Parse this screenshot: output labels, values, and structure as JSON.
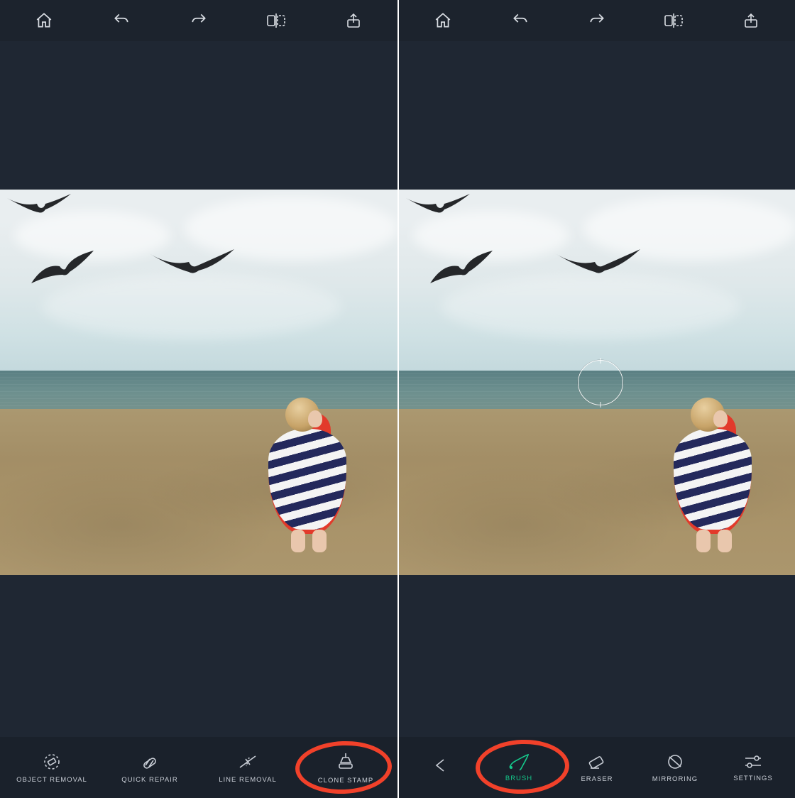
{
  "left": {
    "top_icons": [
      "home-icon",
      "undo-icon",
      "redo-icon",
      "compare-icon",
      "share-icon"
    ],
    "tools": [
      {
        "id": "object-removal",
        "label": "OBJECT REMOVAL"
      },
      {
        "id": "quick-repair",
        "label": "QUICK REPAIR"
      },
      {
        "id": "line-removal",
        "label": "LINE REMOVAL"
      },
      {
        "id": "clone-stamp",
        "label": "CLONE STAMP"
      }
    ],
    "highlighted_tool": "clone-stamp"
  },
  "right": {
    "top_icons": [
      "home-icon",
      "undo-icon",
      "redo-icon",
      "compare-icon",
      "share-icon"
    ],
    "tools": [
      {
        "id": "back",
        "label": ""
      },
      {
        "id": "brush",
        "label": "BRUSH"
      },
      {
        "id": "eraser",
        "label": "ERASER"
      },
      {
        "id": "mirroring",
        "label": "MIRRORING"
      },
      {
        "id": "settings",
        "label": "SETTINGS"
      }
    ],
    "highlighted_tool": "brush",
    "active_tool": "brush",
    "clone_cursor_visible": true
  },
  "colors": {
    "highlight": "#f1412a",
    "active": "#15c98b",
    "bg": "#1f2733"
  }
}
